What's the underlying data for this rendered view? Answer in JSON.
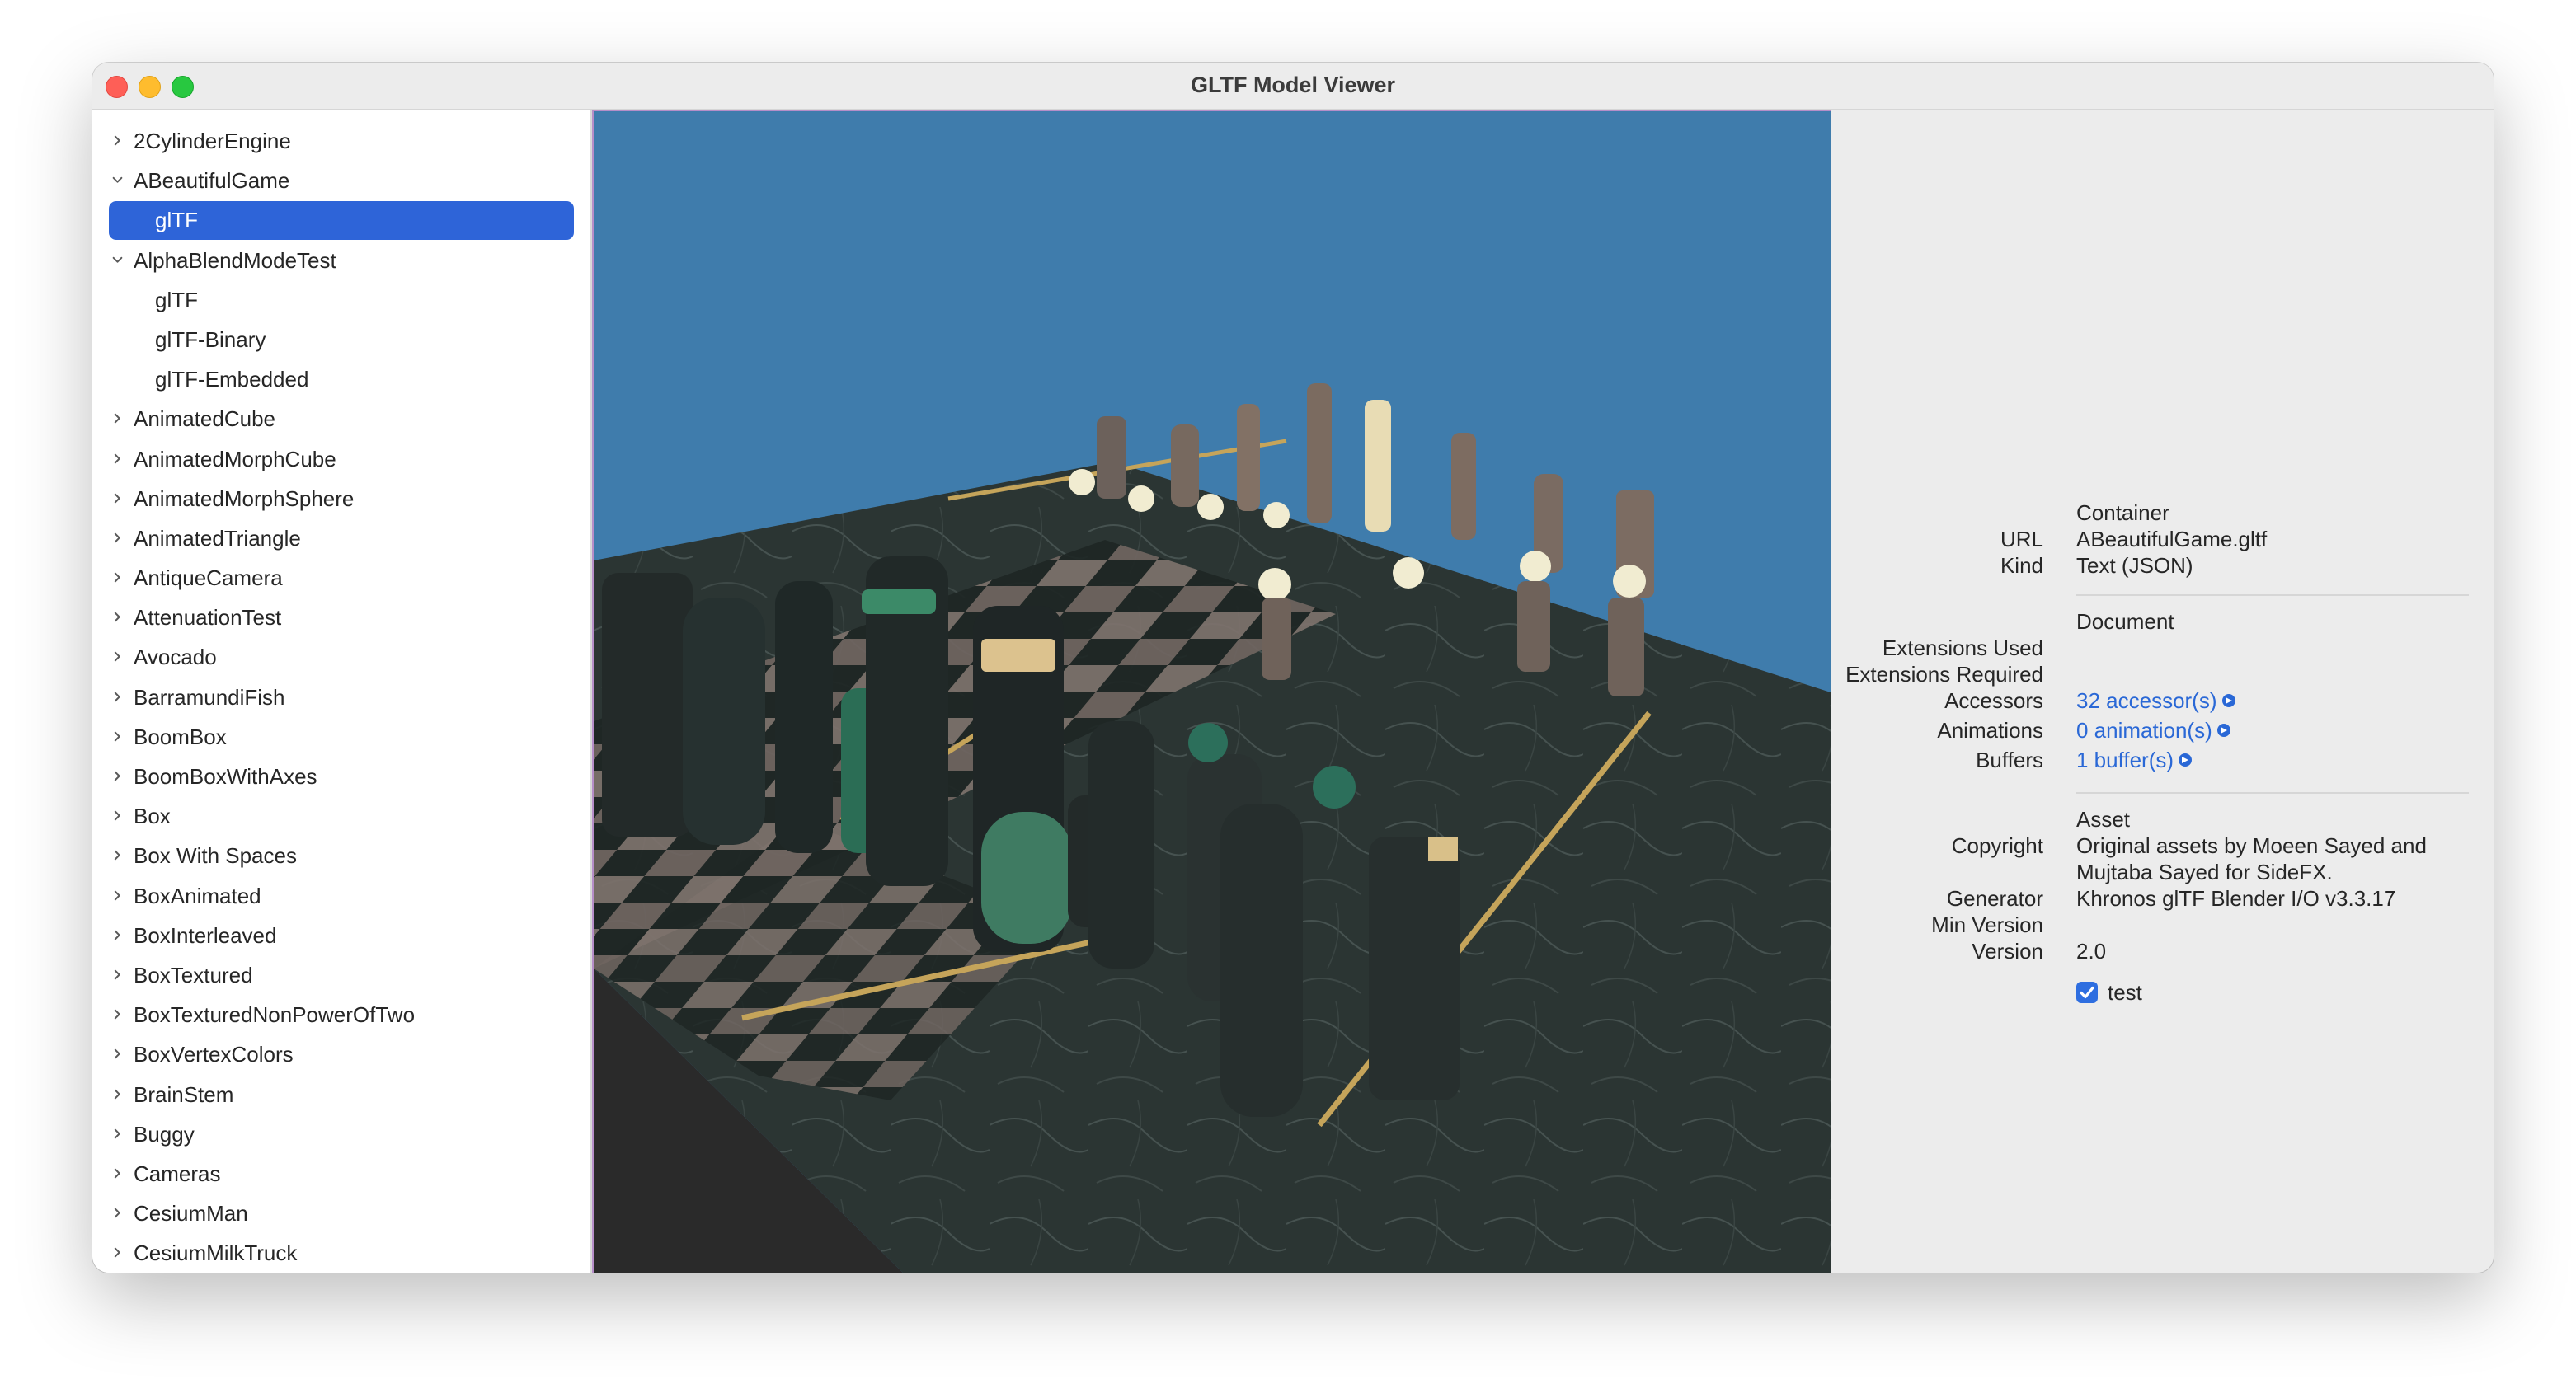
{
  "window": {
    "title": "GLTF Model Viewer"
  },
  "sidebar": {
    "items": [
      {
        "label": "2CylinderEngine",
        "level": 0,
        "expanded": false,
        "selected": false
      },
      {
        "label": "ABeautifulGame",
        "level": 0,
        "expanded": true,
        "selected": false
      },
      {
        "label": "glTF",
        "level": 1,
        "selected": true
      },
      {
        "label": "AlphaBlendModeTest",
        "level": 0,
        "expanded": true,
        "selected": false
      },
      {
        "label": "glTF",
        "level": 1,
        "selected": false
      },
      {
        "label": "glTF-Binary",
        "level": 1,
        "selected": false
      },
      {
        "label": "glTF-Embedded",
        "level": 1,
        "selected": false
      },
      {
        "label": "AnimatedCube",
        "level": 0,
        "expanded": false,
        "selected": false
      },
      {
        "label": "AnimatedMorphCube",
        "level": 0,
        "expanded": false,
        "selected": false
      },
      {
        "label": "AnimatedMorphSphere",
        "level": 0,
        "expanded": false,
        "selected": false
      },
      {
        "label": "AnimatedTriangle",
        "level": 0,
        "expanded": false,
        "selected": false
      },
      {
        "label": "AntiqueCamera",
        "level": 0,
        "expanded": false,
        "selected": false
      },
      {
        "label": "AttenuationTest",
        "level": 0,
        "expanded": false,
        "selected": false
      },
      {
        "label": "Avocado",
        "level": 0,
        "expanded": false,
        "selected": false
      },
      {
        "label": "BarramundiFish",
        "level": 0,
        "expanded": false,
        "selected": false
      },
      {
        "label": "BoomBox",
        "level": 0,
        "expanded": false,
        "selected": false
      },
      {
        "label": "BoomBoxWithAxes",
        "level": 0,
        "expanded": false,
        "selected": false
      },
      {
        "label": "Box",
        "level": 0,
        "expanded": false,
        "selected": false
      },
      {
        "label": "Box With Spaces",
        "level": 0,
        "expanded": false,
        "selected": false
      },
      {
        "label": "BoxAnimated",
        "level": 0,
        "expanded": false,
        "selected": false
      },
      {
        "label": "BoxInterleaved",
        "level": 0,
        "expanded": false,
        "selected": false
      },
      {
        "label": "BoxTextured",
        "level": 0,
        "expanded": false,
        "selected": false
      },
      {
        "label": "BoxTexturedNonPowerOfTwo",
        "level": 0,
        "expanded": false,
        "selected": false
      },
      {
        "label": "BoxVertexColors",
        "level": 0,
        "expanded": false,
        "selected": false
      },
      {
        "label": "BrainStem",
        "level": 0,
        "expanded": false,
        "selected": false
      },
      {
        "label": "Buggy",
        "level": 0,
        "expanded": false,
        "selected": false
      },
      {
        "label": "Cameras",
        "level": 0,
        "expanded": false,
        "selected": false
      },
      {
        "label": "CesiumMan",
        "level": 0,
        "expanded": false,
        "selected": false
      },
      {
        "label": "CesiumMilkTruck",
        "level": 0,
        "expanded": false,
        "selected": false
      }
    ]
  },
  "viewport": {
    "background_color": "#3f7cac"
  },
  "inspector": {
    "container": {
      "header": "Container",
      "url_label": "URL",
      "url_value": "ABeautifulGame.gltf",
      "kind_label": "Kind",
      "kind_value": "Text (JSON)"
    },
    "document": {
      "header": "Document",
      "extensions_used_label": "Extensions Used",
      "extensions_required_label": "Extensions Required",
      "accessors_label": "Accessors",
      "accessors_value": "32 accessor(s)",
      "animations_label": "Animations",
      "animations_value": "0 animation(s)",
      "buffers_label": "Buffers",
      "buffers_value": "1 buffer(s)"
    },
    "asset": {
      "header": "Asset",
      "copyright_label": "Copyright",
      "copyright_line1": "Original assets by Moeen Sayed and",
      "copyright_line2": "Mujtaba Sayed for SideFX.",
      "generator_label": "Generator",
      "generator_value": "Khronos glTF Blender I/O v3.3.17",
      "min_version_label": "Min Version",
      "version_label": "Version",
      "version_value": "2.0"
    },
    "test_checkbox": {
      "label": "test",
      "checked": true
    }
  },
  "colors": {
    "selection": "#2e64d8",
    "link": "#2a68d6",
    "accent": "#2e6ee0"
  }
}
